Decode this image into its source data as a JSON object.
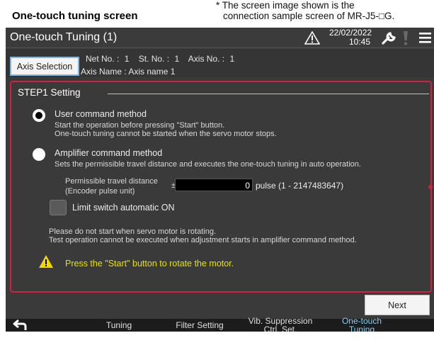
{
  "caption": "One-touch tuning screen",
  "note": {
    "line1": "* The screen image shown is the",
    "line2": "connection sample screen of MR-J5-□G."
  },
  "titlebar": {
    "title": "One-touch Tuning (1)",
    "date": "22/02/2022",
    "time": "10:45",
    "icons": [
      "warning-triangle-icon",
      "wrench-icon",
      "alert-exclamation-icon",
      "menu-icon"
    ]
  },
  "axis": {
    "button_label": "Axis Selection",
    "net_label": "Net No. :",
    "net_value": "1",
    "st_label": "St. No. :",
    "st_value": "1",
    "axis_label": "Axis No. :",
    "axis_value": "1",
    "name_label": "Axis Name :",
    "name_value": "Axis name 1"
  },
  "step": {
    "title": "STEP1 Setting",
    "options": [
      {
        "label": "User command method",
        "selected": true,
        "desc1": "Start the operation before pressing \"Start\" button.",
        "desc2": "One-touch tuning cannot be started when the servo motor stops."
      },
      {
        "label": "Amplifier command method",
        "selected": false,
        "desc1": "Sets the permissible travel distance and executes the one-touch tuning in auto operation."
      }
    ],
    "permissible": {
      "label1": "Permissible travel distance",
      "label2": "(Encoder pulse unit)",
      "sign": "±",
      "value": "0",
      "unit": "pulse (1 - 2147483647)"
    },
    "limit_switch_label": "Limit switch automatic ON",
    "limit_switch_checked": false,
    "notice1": "Please do not start when servo motor is rotating.",
    "notice2": "Test operation cannot be executed when adjustment starts in amplifier command method.",
    "warning": "Press the \"Start\" button to rotate the motor."
  },
  "next_label": "Next",
  "tabs": [
    {
      "line1": "Tuning",
      "line2": "",
      "active": false
    },
    {
      "line1": "Filter Setting",
      "line2": "",
      "active": false
    },
    {
      "line1": "Vib. Suppression",
      "line2": "Ctrl. Set.",
      "active": false
    },
    {
      "line1": "One-touch",
      "line2": "Tuning",
      "active": true
    }
  ],
  "colors": {
    "panel_border": "#d0223a",
    "active_tab": "#7fd0f8",
    "warning_text": "#e8e200",
    "background": "#3a3a3a"
  }
}
